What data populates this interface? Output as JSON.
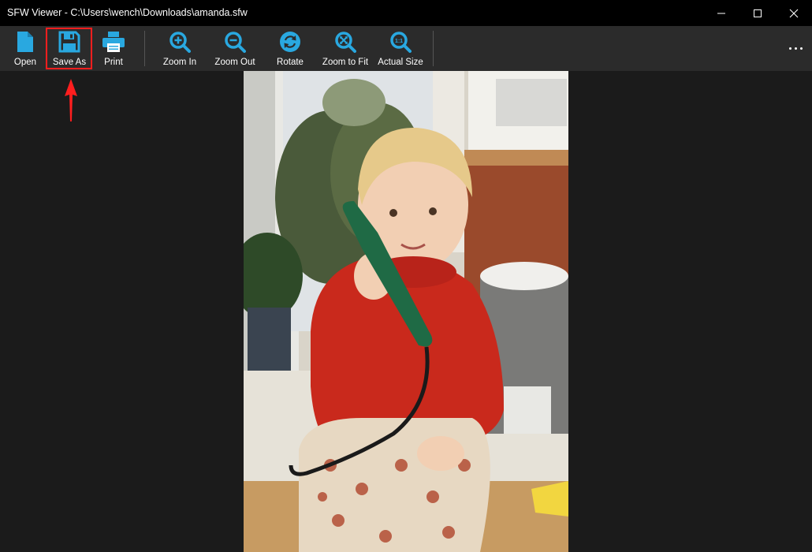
{
  "window": {
    "title": "SFW Viewer - C:\\Users\\wench\\Downloads\\amanda.sfw",
    "controls": [
      "minimize-icon",
      "maximize-icon",
      "close-icon"
    ]
  },
  "toolbar": {
    "open_label": "Open",
    "save_as_label": "Save As",
    "print_label": "Print",
    "zoom_in_label": "Zoom In",
    "zoom_out_label": "Zoom Out",
    "rotate_label": "Rotate",
    "zoom_to_fit_label": "Zoom to Fit",
    "actual_size_label": "Actual Size",
    "actual_size_icon_text": "1:1",
    "more_icon": "more-horizontal-icon",
    "icon_color": "#29a8e0",
    "highlighted_button": "Save As",
    "highlight_color": "#ff1e1e"
  },
  "image": {
    "alt": "Photograph of a toddler in a red sweater holding a green telephone handset, sitting on a kitchen counter"
  }
}
